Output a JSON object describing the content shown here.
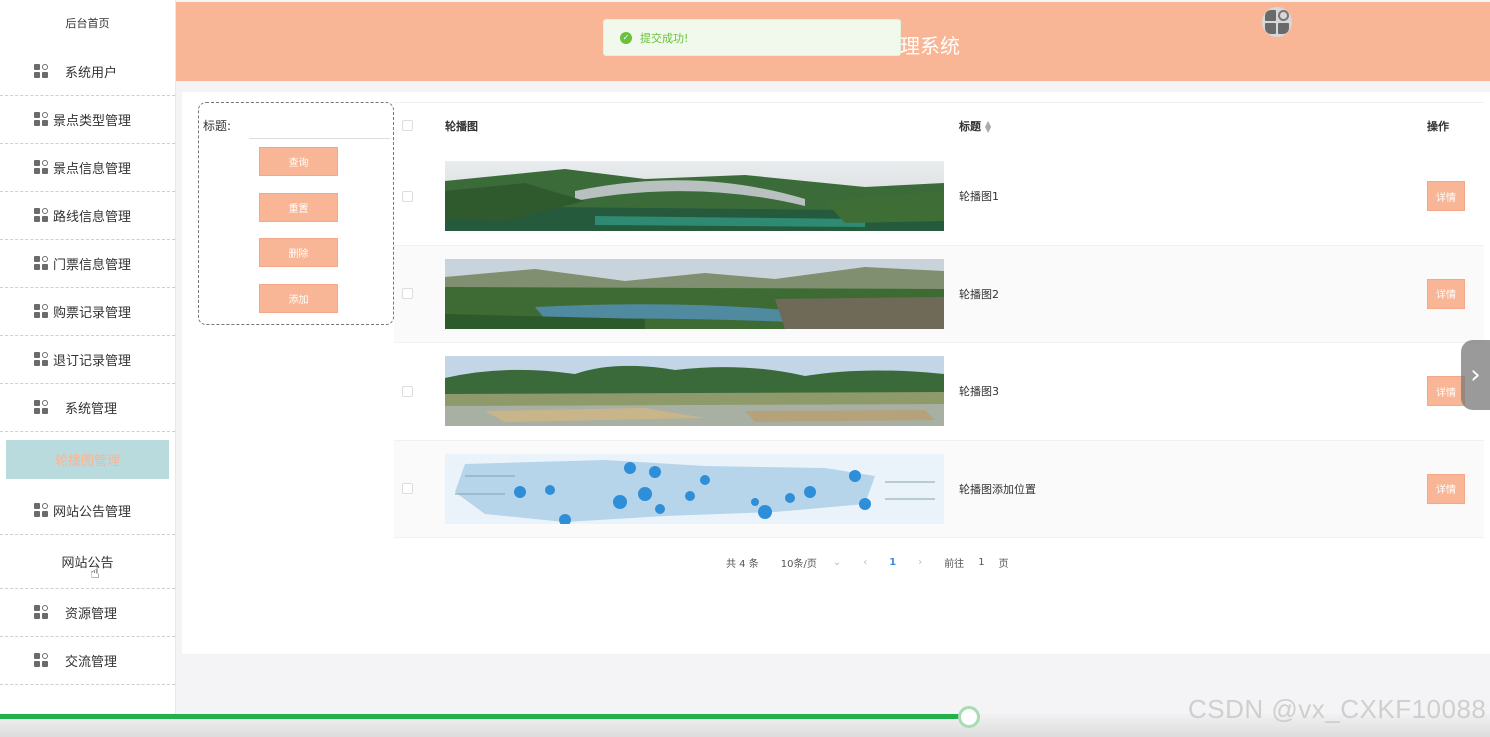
{
  "sidebar": {
    "home": "后台首页",
    "items": [
      {
        "label": "系统用户"
      },
      {
        "label": "景点类型管理"
      },
      {
        "label": "景点信息管理"
      },
      {
        "label": "路线信息管理"
      },
      {
        "label": "门票信息管理"
      },
      {
        "label": "购票记录管理"
      },
      {
        "label": "退订记录管理"
      },
      {
        "label": "系统管理"
      }
    ],
    "active_item": "轮播图管理",
    "after_items": [
      {
        "label": "网站公告管理"
      }
    ],
    "sub_item": "网站公告",
    "tail_items": [
      {
        "label": "资源管理"
      },
      {
        "label": "交流管理"
      }
    ]
  },
  "header": {
    "title_fragment": "理系统",
    "toast": "提交成功!"
  },
  "search": {
    "label": "标题:",
    "value": "",
    "buttons": {
      "query": "查询",
      "reset": "重置",
      "delete": "删除",
      "add": "添加"
    }
  },
  "table": {
    "columns": {
      "image": "轮播图",
      "title": "标题",
      "action": "操作"
    },
    "rows": [
      {
        "title": "轮播图1",
        "action": "详情",
        "image": "scenery-gorge-bridge"
      },
      {
        "title": "轮播图2",
        "action": "详情",
        "image": "scenery-lake-valley"
      },
      {
        "title": "轮播图3",
        "action": "详情",
        "image": "scenery-wetland-hills"
      },
      {
        "title": "轮播图添加位置",
        "action": "详情",
        "image": "map-with-markers"
      }
    ]
  },
  "pagination": {
    "total": "共 4 条",
    "page_size": "10条/页",
    "current": "1",
    "goto_label": "前往",
    "goto_value": "1",
    "page_suffix": "页"
  },
  "video": {
    "progress_fraction": 0.65
  },
  "watermark": "CSDN @vx_CXKF10088",
  "colors": {
    "accent": "#f9b696",
    "active_bg": "#b9dbdd",
    "progress": "#22b14c",
    "toast_text": "#67c23a"
  }
}
